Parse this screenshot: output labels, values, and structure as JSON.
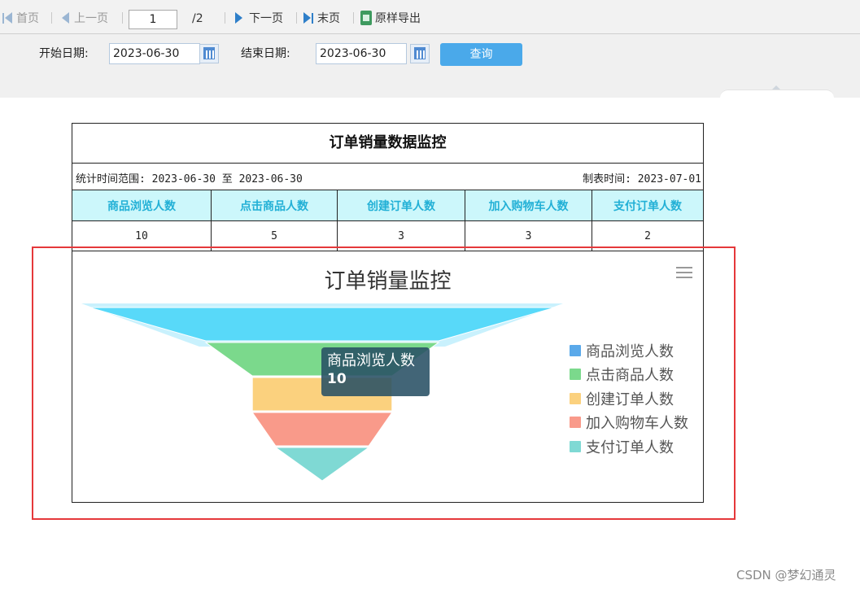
{
  "toolbar": {
    "first": "首页",
    "prev": "上一页",
    "page_value": "1",
    "page_total": "/2",
    "next": "下一页",
    "last": "末页",
    "export": "原样导出"
  },
  "filters": {
    "start_label": "开始日期:",
    "start_value": "2023-06-30",
    "end_label": "结束日期:",
    "end_value": "2023-06-30",
    "query": "查询"
  },
  "report": {
    "title": "订单销量数据监控",
    "range": "统计时间范围: 2023-06-30 至 2023-06-30",
    "made": "制表时间: 2023-07-01",
    "headers": [
      "商品浏览人数",
      "点击商品人数",
      "创建订单人数",
      "加入购物车人数",
      "支付订单人数"
    ],
    "values": [
      "10",
      "5",
      "3",
      "3",
      "2"
    ]
  },
  "chart_data": {
    "type": "funnel",
    "title": "订单销量监控",
    "categories": [
      "商品浏览人数",
      "点击商品人数",
      "创建订单人数",
      "加入购物车人数",
      "支付订单人数"
    ],
    "values": [
      10,
      5,
      3,
      3,
      2
    ],
    "colors": [
      "#58d9f9",
      "#7bd98c",
      "#fbd17e",
      "#f99a8a",
      "#7fd9d4"
    ],
    "legend_colors": [
      "#5aa9ea",
      "#7bd98c",
      "#fbd17e",
      "#f99a8a",
      "#7fd9d4"
    ],
    "legend_position": "right",
    "tooltip": {
      "label": "商品浏览人数",
      "value": "10"
    }
  },
  "watermark": "CSDN @梦幻通灵"
}
